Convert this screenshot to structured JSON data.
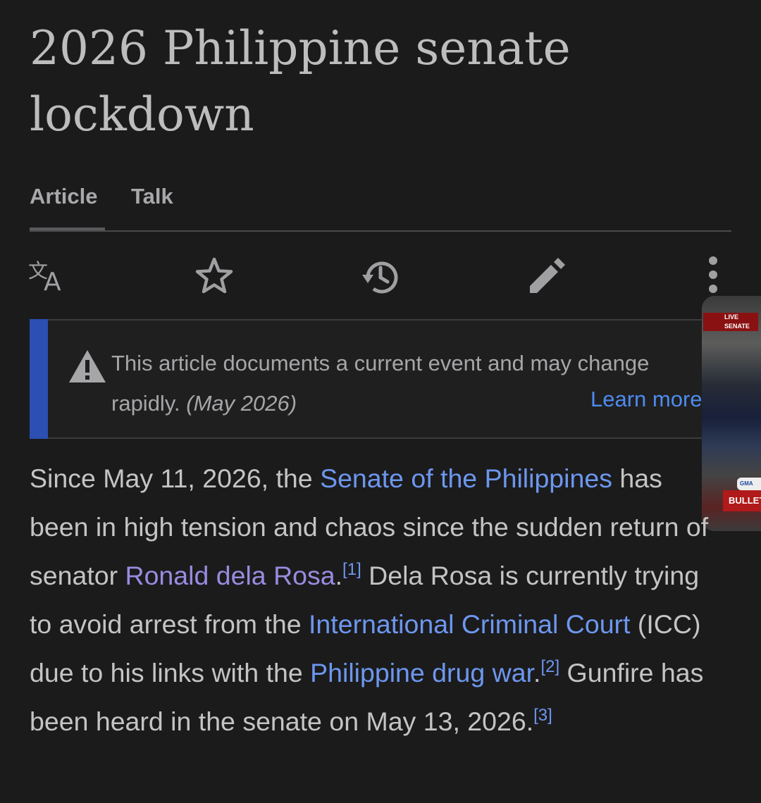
{
  "article": {
    "title": "2026 Philippine senate lockdown"
  },
  "tabs": [
    {
      "label": "Article"
    },
    {
      "label": "Talk"
    }
  ],
  "toolbar": {
    "icons": [
      "translate-icon",
      "star-icon",
      "history-icon",
      "edit-pencil-icon",
      "more-vert-icon"
    ]
  },
  "notice": {
    "text": "This article documents a current event and may change",
    "text2": "rapidly.",
    "date": "(May 2026)",
    "learn_more": "Learn more"
  },
  "video": {
    "live": "LIVE",
    "channel": "SENATE",
    "network": "GMA NEWS",
    "banner": "BULLETIN"
  },
  "paragraph": {
    "t1": "Since May 11, 2026, the ",
    "link1": "Senate of the Philippines",
    "t2": " has been in high tension and chaos since the sudden return of senator ",
    "link2": "Ronald dela Rosa",
    "t3": ".",
    "ref1": "[1]",
    "t4": " Dela Rosa is currently trying to avoid arrest from the ",
    "link3": "International Criminal Court",
    "t5": " (ICC) due to his links with the ",
    "link4": "Philippine drug war",
    "t6": ".",
    "ref2": "[2]",
    "t7": " Gunfire has been heard in the senate on May 13, 2026.",
    "ref3": "[3]"
  },
  "colors": {
    "link": "#6d97ef",
    "visited_link": "#9a8be0",
    "notice_bar": "#2b4fb2",
    "background": "#1b1b1c"
  }
}
